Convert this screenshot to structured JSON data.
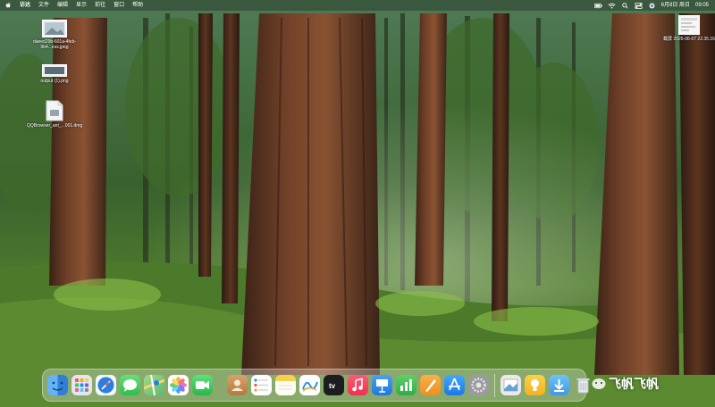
{
  "menubar": {
    "app_name": "访达",
    "items": [
      "文件",
      "编辑",
      "显示",
      "前往",
      "窗口",
      "帮助"
    ],
    "date": "6月8日 周日",
    "time": "09:05"
  },
  "desktop": {
    "files": [
      {
        "label": "daeed29b-601a-4feb-9b4...ess.jpeg",
        "icon": "image-file-icon"
      },
      {
        "label": "output (1).png",
        "icon": "image-file-icon"
      },
      {
        "label": "QQBrowser_ant_...001.dmg",
        "icon": "disk-image-file-icon"
      }
    ],
    "screenshot": {
      "label": "截屏 2025-06-07 22.35.16",
      "icon": "screenshot-file-icon"
    }
  },
  "dock": {
    "apps": [
      {
        "name": "finder-icon",
        "color": "#3a8ee6"
      },
      {
        "name": "launchpad-icon",
        "color": "#e0e4ea"
      },
      {
        "name": "safari-icon",
        "color": "#2a7fe0"
      },
      {
        "name": "messages-icon",
        "color": "#3fcb5a"
      },
      {
        "name": "maps-icon",
        "color": "#5fb86e"
      },
      {
        "name": "photos-icon",
        "color": "#f2f2f2"
      },
      {
        "name": "facetime-icon",
        "color": "#36c45a"
      },
      {
        "name": "contacts-icon",
        "color": "#c48c4a"
      },
      {
        "name": "reminders-icon",
        "color": "#f4f4f4"
      },
      {
        "name": "notes-icon",
        "color": "#f6d24a"
      },
      {
        "name": "freeform-icon",
        "color": "#f6f6f6"
      },
      {
        "name": "apple-tv-icon",
        "color": "#1d1d1f"
      },
      {
        "name": "music-icon",
        "color": "#f2405a"
      },
      {
        "name": "keynote-icon",
        "color": "#2e8cf0"
      },
      {
        "name": "numbers-icon",
        "color": "#3dbb55"
      },
      {
        "name": "pages-icon",
        "color": "#f3a22f"
      },
      {
        "name": "app-store-icon",
        "color": "#2a8ff0"
      },
      {
        "name": "system-settings-icon",
        "color": "#8e8e93"
      }
    ],
    "recent_apps": [
      {
        "name": "preview-icon",
        "color": "#eaeaea"
      },
      {
        "name": "tips-icon",
        "color": "#f6c234"
      },
      {
        "name": "downloads-icon",
        "color": "#4aa8f0"
      }
    ],
    "trash": {
      "name": "trash-icon",
      "color": "#dfe3e8"
    }
  },
  "watermark": "飞帆飞帆"
}
